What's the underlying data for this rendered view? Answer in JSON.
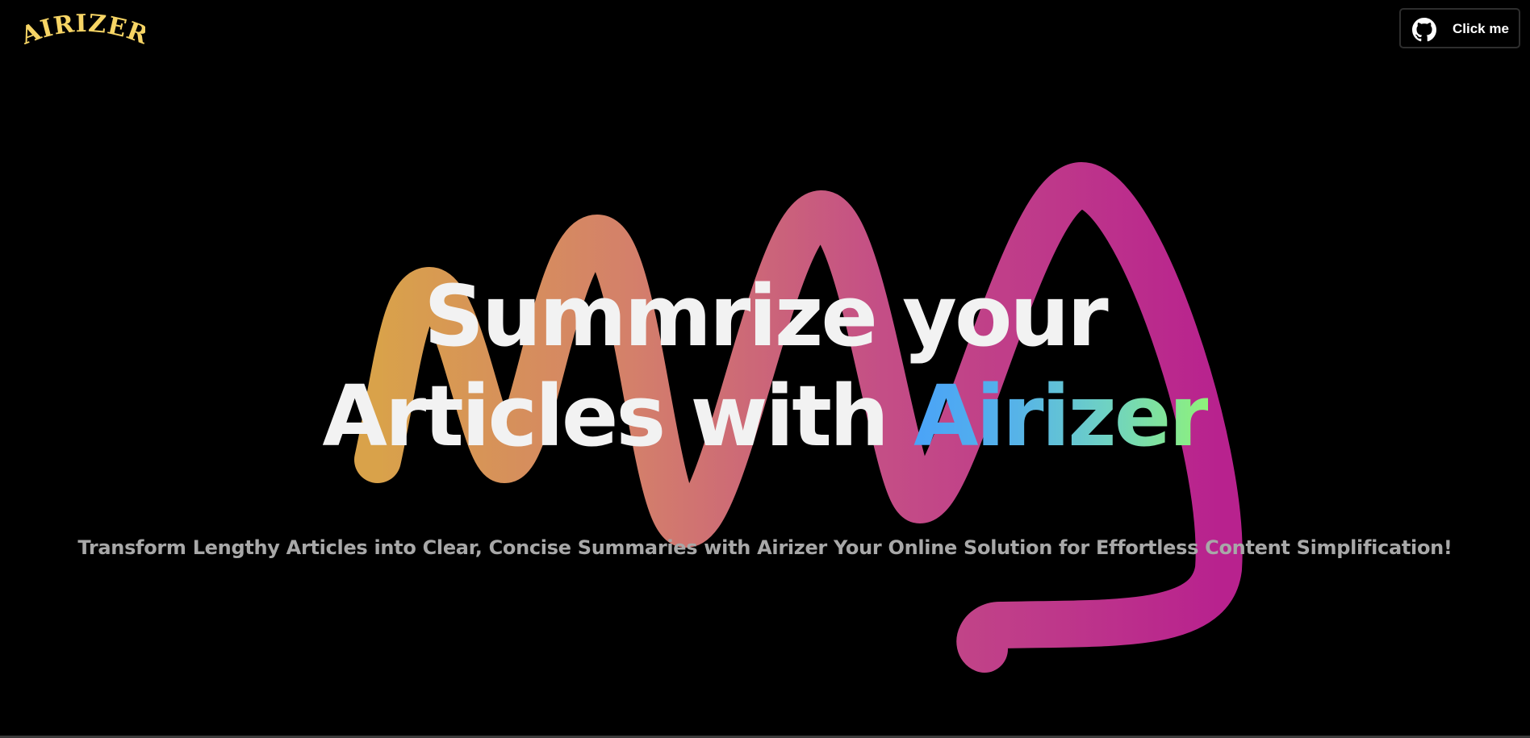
{
  "header": {
    "logo_text": "AIRIZER",
    "github_button_label": "Click me",
    "github_icon": "github-icon"
  },
  "hero": {
    "title_line1": "Summrize your",
    "title_line2_prefix": "Articles with",
    "title_brand": "Airizer",
    "tagline": "Transform Lengthy Articles into Clear, Concise Summaries with Airizer Your Online Solution for Effortless Content Simplification!"
  },
  "colors": {
    "background": "#000000",
    "logo": "#f7d565",
    "title": "#f2f2f2",
    "tagline": "#a8a8a8",
    "brand_gradient": [
      "#4aa3f8",
      "#6ed1c4",
      "#8ff27a"
    ],
    "wave_gradient": [
      "#d9a24a",
      "#d4786a",
      "#c04a8c",
      "#b8228e"
    ]
  }
}
